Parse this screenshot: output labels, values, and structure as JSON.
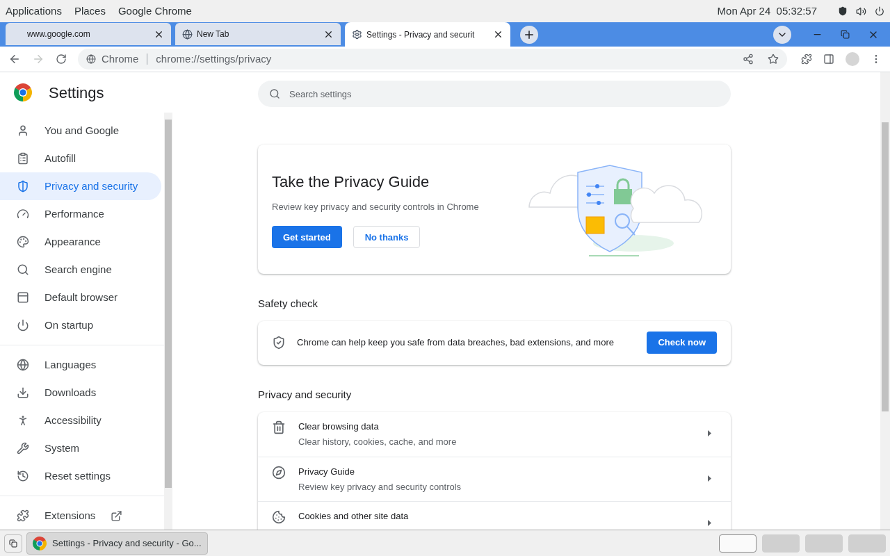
{
  "top_panel": {
    "menus": [
      "Applications",
      "Places",
      "Google Chrome"
    ],
    "clock": "Mon Apr 24  05:32:57"
  },
  "tabs": [
    {
      "title": "www.google.com",
      "selected": false,
      "kind": "blank"
    },
    {
      "title": "New Tab",
      "selected": false,
      "kind": "chrome"
    },
    {
      "title": "Settings - Privacy and securit",
      "selected": true,
      "kind": "settings"
    }
  ],
  "toolbar": {
    "forward_disabled": true,
    "site_label": "Chrome",
    "url": "chrome://settings/privacy"
  },
  "sidebar": {
    "title": "Settings",
    "groups": [
      [
        {
          "label": "You and Google",
          "selected": false
        },
        {
          "label": "Autofill",
          "selected": false
        },
        {
          "label": "Privacy and security",
          "selected": true
        },
        {
          "label": "Performance",
          "selected": false
        },
        {
          "label": "Appearance",
          "selected": false
        },
        {
          "label": "Search engine",
          "selected": false
        },
        {
          "label": "Default browser",
          "selected": false
        },
        {
          "label": "On startup",
          "selected": false
        }
      ],
      [
        {
          "label": "Languages",
          "selected": false
        },
        {
          "label": "Downloads",
          "selected": false
        },
        {
          "label": "Accessibility",
          "selected": false
        },
        {
          "label": "System",
          "selected": false
        },
        {
          "label": "Reset settings",
          "selected": false
        }
      ],
      [
        {
          "label": "Extensions",
          "selected": false,
          "external": true
        }
      ]
    ]
  },
  "search": {
    "placeholder": "Search settings"
  },
  "privacy_guide_card": {
    "title": "Take the Privacy Guide",
    "description": "Review key privacy and security controls in Chrome",
    "buttons": [
      {
        "label": "Get started",
        "kind": "primary"
      },
      {
        "label": "No thanks",
        "kind": "secondary"
      }
    ]
  },
  "safety_check": {
    "heading": "Safety check",
    "text": "Chrome can help keep you safe from data breaches, bad extensions, and more",
    "button": "Check now"
  },
  "privacy_section": {
    "heading": "Privacy and security",
    "rows": [
      {
        "title": "Clear browsing data",
        "subtitle": "Clear history, cookies, cache, and more"
      },
      {
        "title": "Privacy Guide",
        "subtitle": "Review key privacy and security controls"
      },
      {
        "title": "Cookies and other site data"
      }
    ]
  },
  "taskbar": {
    "window": "Settings - Privacy and security - Go...",
    "workspaces": [
      {
        "selected": true
      },
      {
        "selected": false
      },
      {
        "selected": false
      },
      {
        "selected": false
      }
    ]
  }
}
